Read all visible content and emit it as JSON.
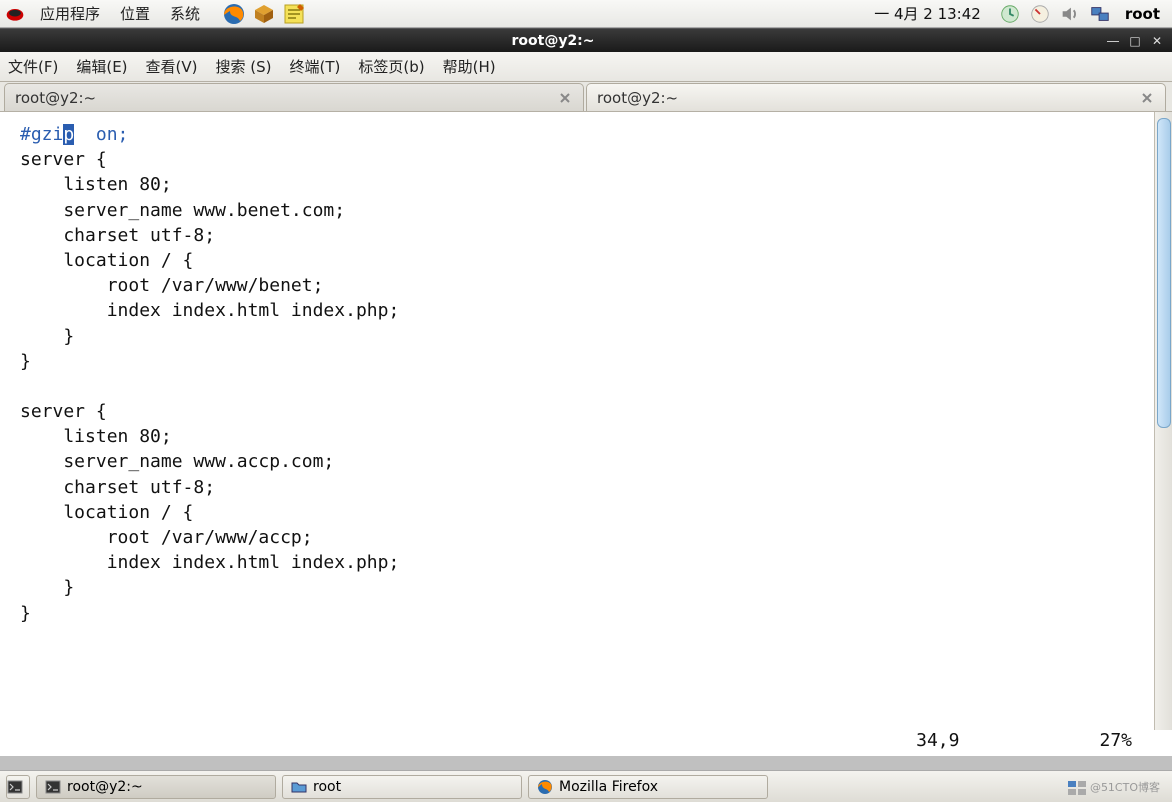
{
  "panel": {
    "menus": {
      "apps": "应用程序",
      "places": "位置",
      "system": "系统"
    },
    "clock": "一  4月  2 13:42",
    "user": "root"
  },
  "window": {
    "title": "root@y2:~"
  },
  "menubar": {
    "file": "文件(F)",
    "edit": "编辑(E)",
    "view": "查看(V)",
    "search": "搜索 (S)",
    "terminal": "终端(T)",
    "tabs": "标签页(b)",
    "help": "帮助(H)"
  },
  "tabs": {
    "tab1": "root@y2:~",
    "tab2": "root@y2:~"
  },
  "terminal": {
    "gzip_prefix": "#gzi",
    "gzip_hl": "p",
    "gzip_rest": "  on;",
    "body": "server {\n    listen 80;\n    server_name www.benet.com;\n    charset utf-8;\n    location / {\n        root /var/www/benet;\n        index index.html index.php;\n    }\n}\n\nserver {\n    listen 80;\n    server_name www.accp.com;\n    charset utf-8;\n    location / {\n        root /var/www/accp;\n        index index.html index.php;\n    }\n}"
  },
  "status": {
    "pos": "34,9",
    "pct": "27%"
  },
  "taskbar": {
    "t1": "root@y2:~",
    "t2": "root",
    "t3": "Mozilla Firefox"
  },
  "watermark": "@51CTO博客"
}
